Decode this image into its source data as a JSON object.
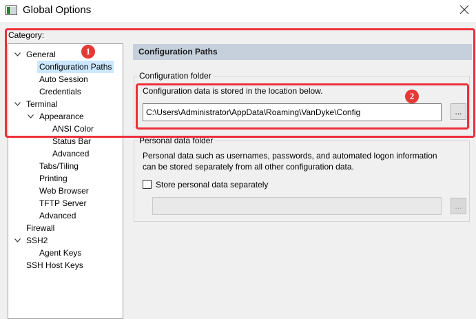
{
  "window": {
    "title": "Global Options",
    "icon": "window-app-icon",
    "close_icon": "close-icon"
  },
  "sidebar": {
    "label": "Category:",
    "items": [
      {
        "label": "General",
        "expanded": true,
        "selected": false
      },
      {
        "label": "Configuration Paths",
        "expanded": false,
        "selected": true
      },
      {
        "label": "Auto Session",
        "expanded": false,
        "selected": false
      },
      {
        "label": "Credentials",
        "expanded": false,
        "selected": false
      },
      {
        "label": "Terminal",
        "expanded": true,
        "selected": false
      },
      {
        "label": "Appearance",
        "expanded": true,
        "selected": false
      },
      {
        "label": "ANSI Color",
        "expanded": false,
        "selected": false
      },
      {
        "label": "Status Bar",
        "expanded": false,
        "selected": false
      },
      {
        "label": "Advanced",
        "expanded": false,
        "selected": false
      },
      {
        "label": "Tabs/Tiling",
        "expanded": false,
        "selected": false
      },
      {
        "label": "Printing",
        "expanded": false,
        "selected": false
      },
      {
        "label": "Web Browser",
        "expanded": false,
        "selected": false
      },
      {
        "label": "TFTP Server",
        "expanded": false,
        "selected": false
      },
      {
        "label": "Advanced",
        "expanded": false,
        "selected": false
      },
      {
        "label": "Firewall",
        "expanded": false,
        "selected": false
      },
      {
        "label": "SSH2",
        "expanded": true,
        "selected": false
      },
      {
        "label": "Agent Keys",
        "expanded": false,
        "selected": false
      },
      {
        "label": "SSH Host Keys",
        "expanded": false,
        "selected": false
      }
    ]
  },
  "main": {
    "header": "Configuration Paths",
    "config_folder": {
      "title": "Configuration folder",
      "description": "Configuration data is stored in the location below.",
      "path": "C:\\Users\\Administrator\\AppData\\Roaming\\VanDyke\\Config",
      "browse_label": "..."
    },
    "personal_folder": {
      "title": "Personal data folder",
      "description_line1": "Personal data such as usernames, passwords, and automated logon information",
      "description_line2": "can be stored separately from all other configuration data.",
      "checkbox_label": "Store personal data separately",
      "checked": false,
      "path": "",
      "browse_label": "..."
    }
  },
  "annotations": {
    "callout_1": "1",
    "callout_2": "2",
    "color": "#ee2f3b"
  }
}
